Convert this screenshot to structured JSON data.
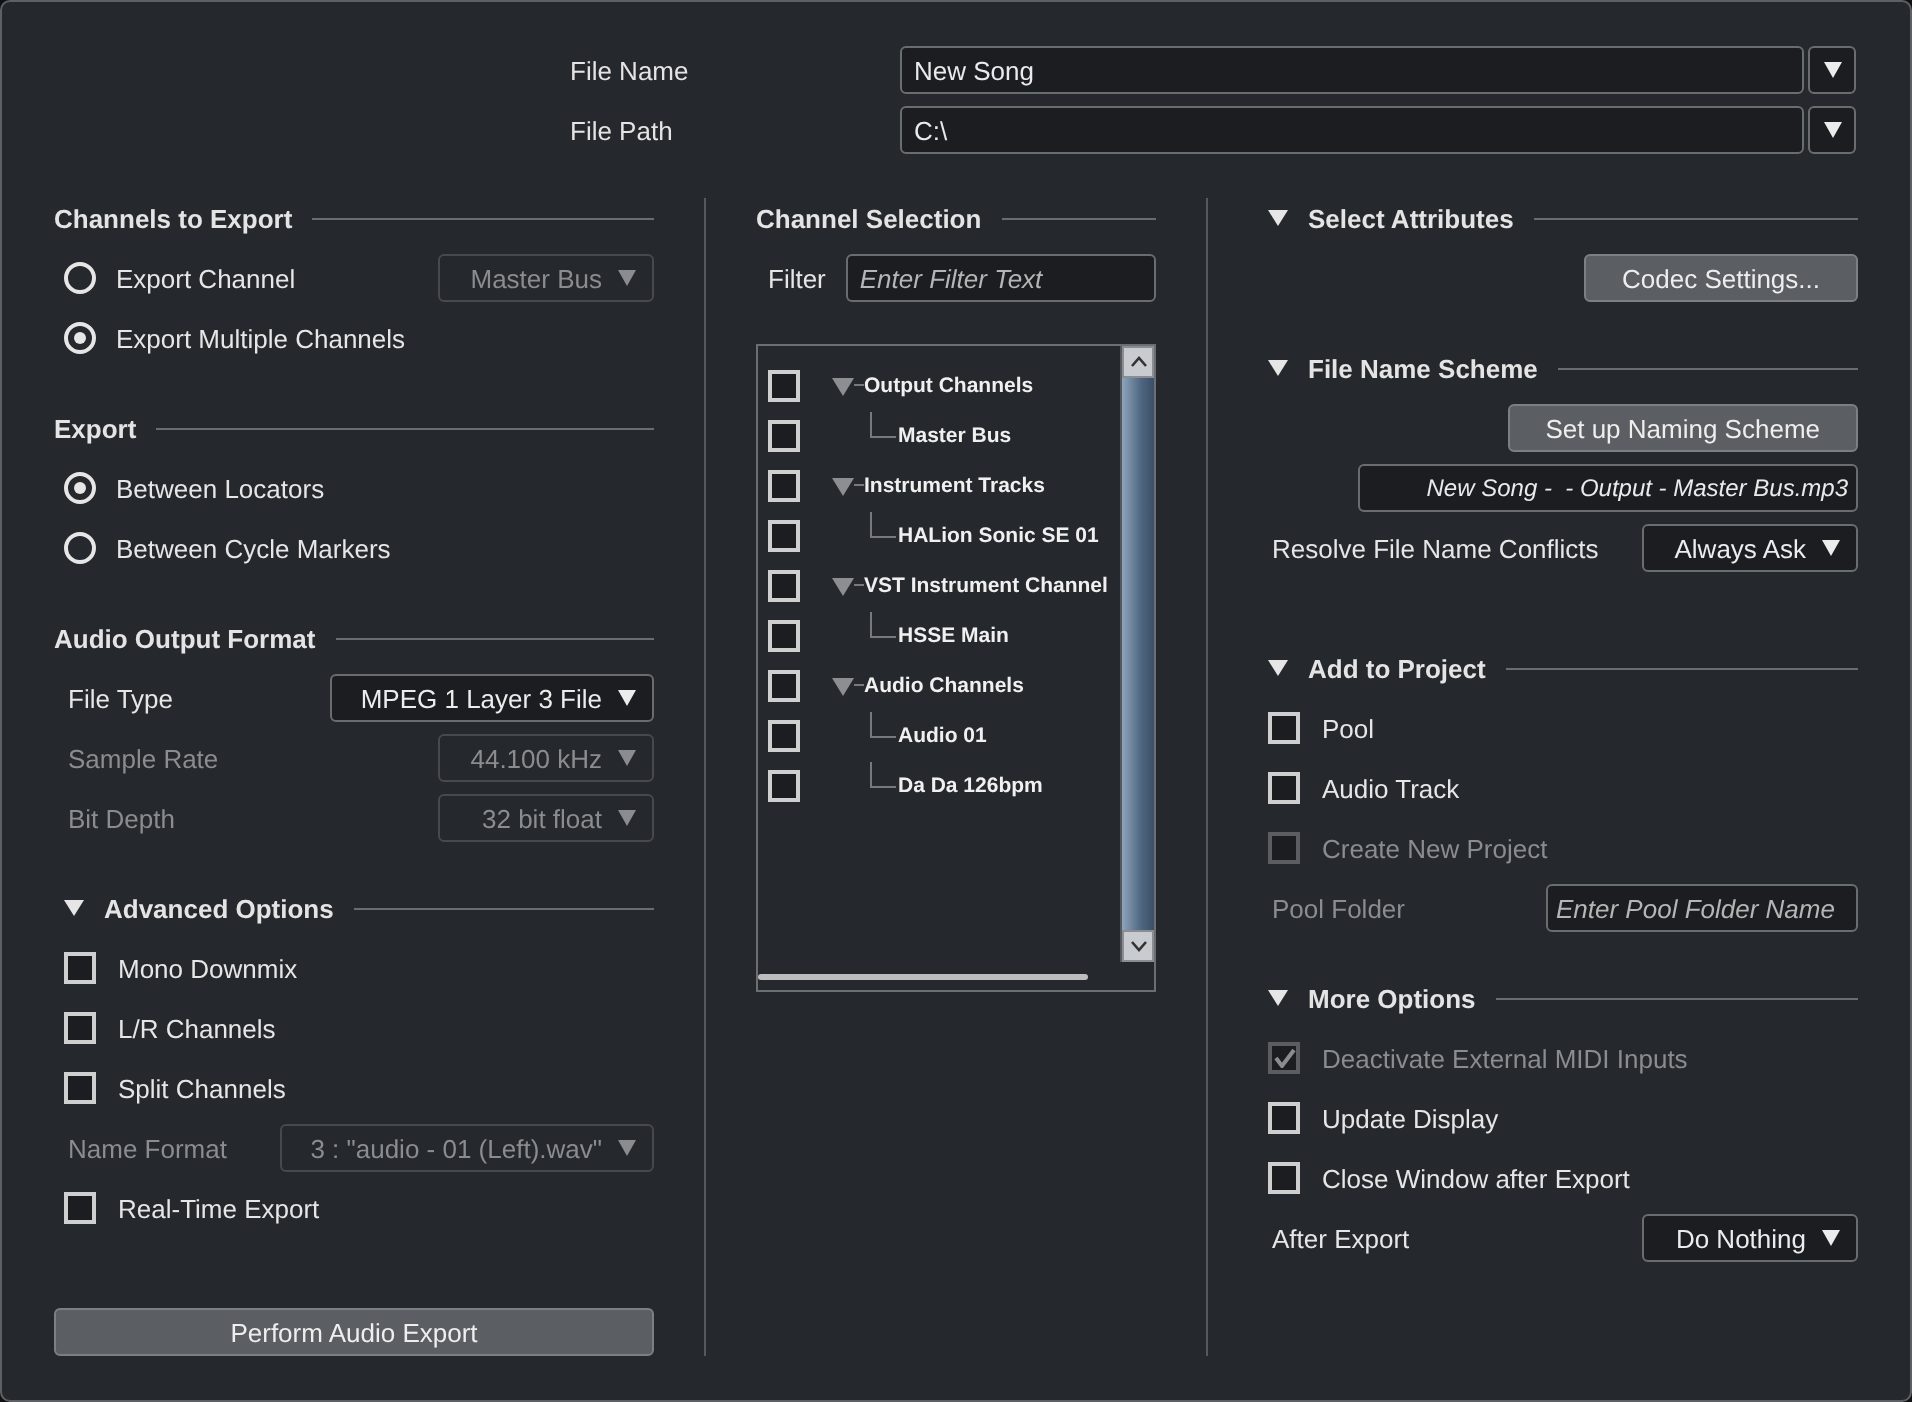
{
  "file_name": {
    "label": "File Name",
    "value": "New Song"
  },
  "file_path": {
    "label": "File Path",
    "value": "C:\\"
  },
  "left": {
    "sections": [
      {
        "title": "Channels to Export",
        "rows": [
          {
            "kind": "radio",
            "label": "Export Channel",
            "selected": false,
            "dropdown": {
              "value": "Master Bus",
              "disabled": true
            }
          },
          {
            "kind": "radio",
            "label": "Export Multiple Channels",
            "selected": true
          }
        ]
      },
      {
        "title": "Export",
        "rows": [
          {
            "kind": "radio",
            "label": "Between Locators",
            "selected": true
          },
          {
            "kind": "radio",
            "label": "Between Cycle Markers",
            "selected": false
          }
        ]
      },
      {
        "title": "Audio Output Format",
        "rows": [
          {
            "kind": "select",
            "label": "File Type",
            "value": "MPEG 1 Layer 3 File",
            "disabled": false
          },
          {
            "kind": "select",
            "label": "Sample Rate",
            "value": "44.100 kHz",
            "disabled": true
          },
          {
            "kind": "select",
            "label": "Bit Depth",
            "value": "32 bit float",
            "disabled": true
          }
        ]
      },
      {
        "title": "Advanced Options",
        "expanded": true,
        "rows": [
          {
            "kind": "checkbox",
            "label": "Mono Downmix",
            "checked": false,
            "disabled": false
          },
          {
            "kind": "checkbox",
            "label": "L/R Channels",
            "checked": false,
            "disabled": false
          },
          {
            "kind": "checkbox",
            "label": "Split Channels",
            "checked": false,
            "disabled": false
          },
          {
            "kind": "select",
            "label": "Name Format",
            "value": "3 : \"audio - 01 (Left).wav\"",
            "disabled": true
          },
          {
            "kind": "checkbox",
            "label": "Real-Time Export",
            "checked": false,
            "disabled": false
          }
        ]
      }
    ],
    "action": "Perform Audio Export"
  },
  "middle": {
    "title": "Channel Selection",
    "filter": {
      "label": "Filter",
      "placeholder": "Enter Filter Text"
    },
    "tree": [
      {
        "label": "Output Channels",
        "checked": false,
        "expanded": true,
        "children": [
          {
            "label": "Master Bus",
            "checked": false
          }
        ]
      },
      {
        "label": "Instrument Tracks",
        "checked": false,
        "expanded": true,
        "children": [
          {
            "label": "HALion Sonic SE 01",
            "checked": false
          }
        ]
      },
      {
        "label": "VST Instrument Channel",
        "checked": false,
        "expanded": true,
        "children": [
          {
            "label": "HSSE Main",
            "checked": false
          }
        ]
      },
      {
        "label": "Audio Channels",
        "checked": false,
        "expanded": true,
        "children": [
          {
            "label": "Audio 01",
            "checked": false
          },
          {
            "label": "Da Da 126bpm",
            "checked": false
          }
        ]
      }
    ]
  },
  "right": {
    "sections": [
      {
        "title": "Select Attributes",
        "expanded": true,
        "rows": [
          {
            "kind": "button",
            "label": "Codec Settings..."
          }
        ]
      },
      {
        "title": "File Name Scheme",
        "expanded": true,
        "rows": [
          {
            "kind": "button",
            "label": "Set up Naming Scheme"
          },
          {
            "kind": "field",
            "value": "New Song -  - Output - Master Bus.mp3"
          },
          {
            "kind": "select",
            "label": "Resolve File Name Conflicts",
            "value": "Always Ask",
            "disabled": false
          }
        ]
      },
      {
        "title": "Add to Project",
        "expanded": true,
        "rows": [
          {
            "kind": "checkbox",
            "label": "Pool",
            "checked": false,
            "disabled": false
          },
          {
            "kind": "checkbox",
            "label": "Audio Track",
            "checked": false,
            "disabled": false
          },
          {
            "kind": "checkbox",
            "label": "Create New Project",
            "checked": false,
            "disabled": true
          },
          {
            "kind": "field",
            "label": "Pool Folder",
            "placeholder": "Enter Pool Folder Name",
            "disabled": true
          }
        ]
      },
      {
        "title": "More Options",
        "expanded": true,
        "rows": [
          {
            "kind": "checkbox",
            "label": "Deactivate External MIDI Inputs",
            "checked": true,
            "disabled": true
          },
          {
            "kind": "checkbox",
            "label": "Update Display",
            "checked": false,
            "disabled": false
          },
          {
            "kind": "checkbox",
            "label": "Close Window after Export",
            "checked": false,
            "disabled": false
          },
          {
            "kind": "select",
            "label": "After Export",
            "value": "Do Nothing",
            "disabled": false
          }
        ]
      }
    ]
  }
}
